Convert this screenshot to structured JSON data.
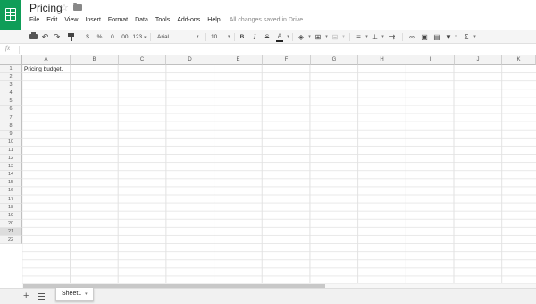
{
  "document": {
    "title": "Pricing",
    "save_status": "All changes saved in Drive"
  },
  "icons": {
    "app": "sheets-logo-icon",
    "star": "star-icon",
    "folder": "folder-icon",
    "star_glyph": "☆"
  },
  "menu": [
    "File",
    "Edit",
    "View",
    "Insert",
    "Format",
    "Data",
    "Tools",
    "Add-ons",
    "Help"
  ],
  "toolbar": {
    "currency": "$",
    "percent": "%",
    "decimal_decrease": ".0",
    "decimal_increase": ".00",
    "more_formats": "123",
    "font": "Arial",
    "font_size": "10",
    "bold": "B",
    "italic": "I",
    "strikethrough": "S",
    "text_color": "A",
    "functions": "Σ",
    "caret": "▾"
  },
  "formula_bar": {
    "fx": "fx",
    "value": ""
  },
  "grid": {
    "columns": [
      "A",
      "B",
      "C",
      "D",
      "E",
      "F",
      "G",
      "H",
      "I",
      "J",
      "K"
    ],
    "rows": [
      "1",
      "2",
      "3",
      "4",
      "5",
      "6",
      "7",
      "8",
      "9",
      "10",
      "11",
      "12",
      "13",
      "14",
      "15",
      "16",
      "17",
      "18",
      "19",
      "20",
      "21",
      "22"
    ],
    "selected_row": "21",
    "cell_a1": "Pricing budget."
  },
  "sheets": {
    "add": "+",
    "tabs": [
      {
        "label": "Sheet1"
      }
    ]
  },
  "colors": {
    "brand": "#0f9d58"
  }
}
